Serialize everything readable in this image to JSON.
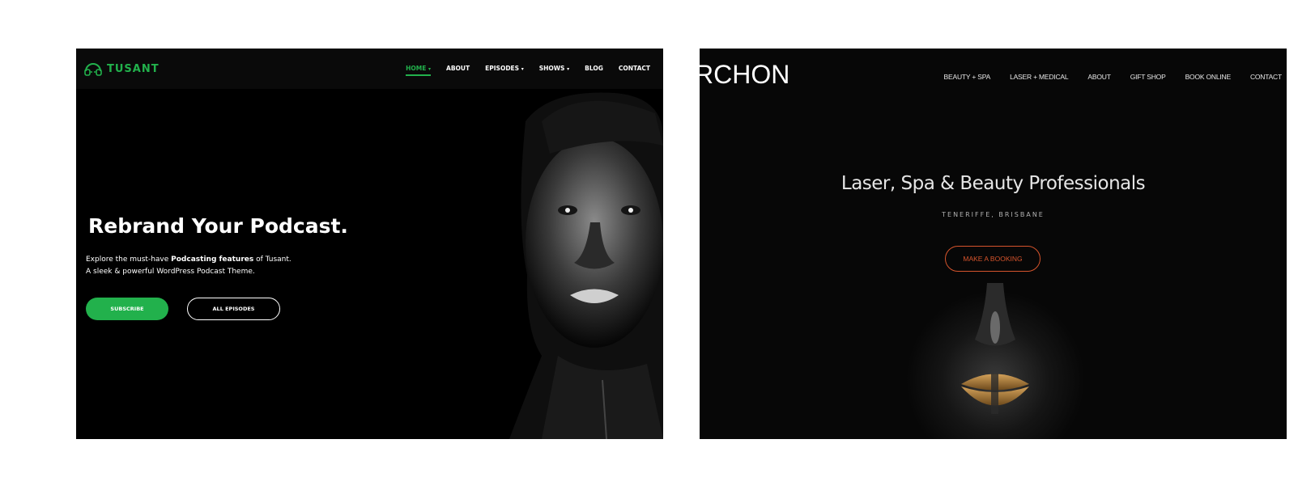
{
  "left": {
    "logo": "TUSANT",
    "nav": [
      {
        "label": "HOME",
        "dropdown": true,
        "active": true
      },
      {
        "label": "ABOUT",
        "dropdown": false,
        "active": false
      },
      {
        "label": "EPISODES",
        "dropdown": true,
        "active": false
      },
      {
        "label": "SHOWS",
        "dropdown": true,
        "active": false
      },
      {
        "label": "BLOG",
        "dropdown": false,
        "active": false
      },
      {
        "label": "CONTACT",
        "dropdown": false,
        "active": false
      }
    ],
    "title": "Rebrand Your Podcast.",
    "desc_line1_prefix": "Explore the must-have ",
    "desc_line1_bold": "Podcasting features",
    "desc_line1_suffix": " of Tusant.",
    "desc_line2": "A sleek & powerful WordPress Podcast Theme.",
    "subscribe_label": "SUBSCRIBE",
    "all_episodes_label": "ALL EPISODES",
    "accent": "#22b14c"
  },
  "right": {
    "logo": "RCHON",
    "nav": [
      "BEAUTY + SPA",
      "LASER + MEDICAL",
      "ABOUT",
      "GIFT SHOP",
      "BOOK ONLINE",
      "CONTACT"
    ],
    "title": "Laser, Spa & Beauty Professionals",
    "subtitle": "TENERIFFE, BRISBANE",
    "button_label": "MAKE A BOOKING",
    "accent": "#d6542c"
  }
}
